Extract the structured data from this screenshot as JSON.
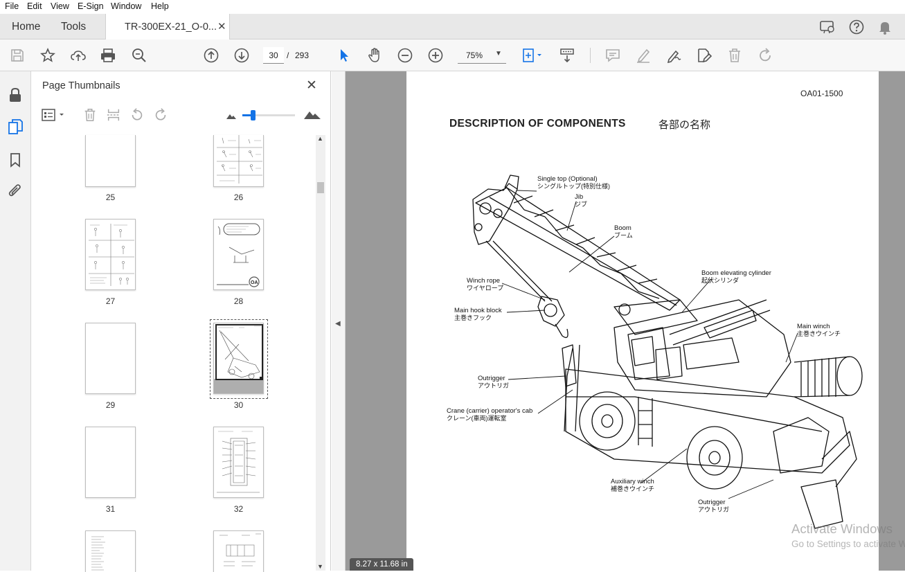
{
  "menu": [
    "File",
    "Edit",
    "View",
    "E-Sign",
    "Window",
    "Help"
  ],
  "tabs": {
    "home": "Home",
    "tools": "Tools",
    "document": "TR-300EX-21_O-0..."
  },
  "toolbar": {
    "current_page": "30",
    "page_separator": "/",
    "total_pages": "293",
    "zoom": "75%"
  },
  "thumbnails_panel": {
    "title": "Page Thumbnails",
    "pages": [
      {
        "label": "25"
      },
      {
        "label": "26"
      },
      {
        "label": "27"
      },
      {
        "label": "28"
      },
      {
        "label": "29"
      },
      {
        "label": "30",
        "selected": true
      },
      {
        "label": "31"
      },
      {
        "label": "32"
      }
    ]
  },
  "document": {
    "doc_code": "OA01-1500",
    "heading": "DESCRIPTION OF COMPONENTS",
    "heading_jp": "各部の名称",
    "labels": [
      {
        "en": "Single top (Optional)",
        "jp": "シングルトップ(特別仕様)"
      },
      {
        "en": "Jib",
        "jp": "ジブ"
      },
      {
        "en": "Boom",
        "jp": "ブーム"
      },
      {
        "en": "Boom elevating cylinder",
        "jp": "起伏シリンダ"
      },
      {
        "en": "Winch rope",
        "jp": "ワイヤロープ"
      },
      {
        "en": "Main hook block",
        "jp": "主巻きフック"
      },
      {
        "en": "Main winch",
        "jp": "主巻きウインチ"
      },
      {
        "en": "Outrigger",
        "jp": "アウトリガ"
      },
      {
        "en": "Crane (carrier) operator's cab",
        "jp": "クレーン(車両)運転室"
      },
      {
        "en": "Auxiliary winch",
        "jp": "補巻きウインチ"
      },
      {
        "en": "Outrigger",
        "jp": "アウトリガ"
      }
    ],
    "page_size": "8.27 x 11.68 in"
  },
  "watermark": {
    "line1": "Activate Windows",
    "line2": "Go to Settings to activate Windows."
  },
  "colors": {
    "accent": "#1473e6",
    "tab_bg": "#e8e8e8",
    "toolbar_bg": "#f7f7f7",
    "doc_bg": "#9a9a9a"
  }
}
